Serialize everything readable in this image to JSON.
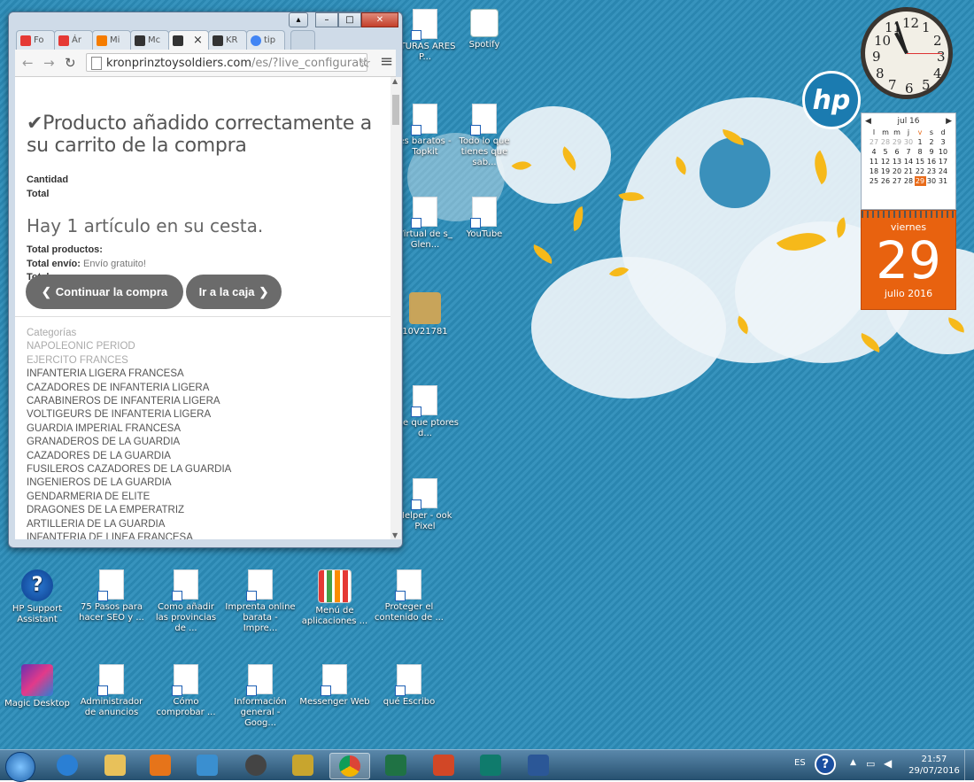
{
  "browser": {
    "tabs": [
      {
        "label": "Fo",
        "color": "#e53935"
      },
      {
        "label": "Ár",
        "color": "#e53935"
      },
      {
        "label": "Mi",
        "color": "#f57c00"
      },
      {
        "label": "Mc",
        "color": "#333333"
      },
      {
        "label": "",
        "color": "#333333"
      },
      {
        "label": "KR",
        "color": "#333333"
      },
      {
        "label": "tip",
        "color": "#4285f4"
      }
    ],
    "active_tab_close": "×",
    "url_domain": "kronprinztoysoldiers.com",
    "url_path": "/es/?live_configurato",
    "menu_icon": "≡",
    "star_icon": "☆"
  },
  "page": {
    "success_title": "Producto añadido correctamente a su carrito de la compra",
    "quantity_label": "Cantidad",
    "total_label": "Total",
    "cart_heading": "Hay 1 artículo en su cesta.",
    "total_products_label": "Total productos:",
    "shipping_label": "Total envío:",
    "shipping_value": "Envío gratuito!",
    "total_label_2": "Total",
    "continue_button": "Continuar la compra",
    "checkout_button": "Ir a la caja",
    "categories_heading": "Categorías",
    "categories": [
      "NAPOLEONIC PERIOD",
      "EJERCITO FRANCES",
      "INFANTERIA LIGERA FRANCESA",
      "CAZADORES DE INFANTERIA LIGERA",
      "CARABINEROS DE INFANTERIA LIGERA",
      "VOLTIGEURS DE INFANTERIA LIGERA",
      "GUARDIA IMPERIAL FRANCESA",
      "GRANADEROS DE LA GUARDIA",
      "CAZADORES DE LA GUARDIA",
      "FUSILEROS CAZADORES DE LA GUARDIA",
      "INGENIEROS DE LA GUARDIA",
      "GENDARMERIA DE ELITE",
      "DRAGONES DE LA EMPERATRIZ",
      "ARTILLERIA DE LA GUARDIA",
      "INFANTERIA DE LINEA FRANCESA"
    ]
  },
  "desktop": {
    "icons_right": [
      {
        "label": "Spotify"
      },
      {
        "label": "Todo lo que tienes que sab..."
      },
      {
        "label": "YouTube"
      }
    ],
    "partial_labels": [
      "ATURAS ARES P...",
      "es baratos - Topkit",
      "Virtual de s_ Glen...",
      "10V21781",
      "nite que ptores d...",
      "Helper - ook Pixel"
    ],
    "icons_row1": [
      {
        "label": "HP Support Assistant"
      },
      {
        "label": "75 Pasos para hacer SEO y ..."
      },
      {
        "label": "Como añadir las provincias de ..."
      },
      {
        "label": "Imprenta online barata - Impre..."
      },
      {
        "label": "Menú de aplicaciones ..."
      },
      {
        "label": "Proteger el contenido de ..."
      }
    ],
    "icons_row2": [
      {
        "label": "Magic Desktop"
      },
      {
        "label": "Administrador de anuncios"
      },
      {
        "label": "Cómo comprobar ..."
      },
      {
        "label": "Información general - Goog..."
      },
      {
        "label": "Messenger Web"
      },
      {
        "label": "qué Escribo"
      }
    ]
  },
  "gadgets": {
    "clock_numbers": [
      "12",
      "1",
      "2",
      "3",
      "4",
      "5",
      "6",
      "7",
      "8",
      "9",
      "10",
      "11"
    ],
    "calendar_month": "jul 16",
    "calendar_days_header": [
      "l",
      "m",
      "m",
      "j",
      "v",
      "s",
      "d"
    ],
    "calendar_weeks": [
      [
        "27",
        "28",
        "29",
        "30",
        "1",
        "2",
        "3"
      ],
      [
        "4",
        "5",
        "6",
        "7",
        "8",
        "9",
        "10"
      ],
      [
        "11",
        "12",
        "13",
        "14",
        "15",
        "16",
        "17"
      ],
      [
        "18",
        "19",
        "20",
        "21",
        "22",
        "23",
        "24"
      ],
      [
        "25",
        "26",
        "27",
        "28",
        "29",
        "30",
        "31"
      ]
    ],
    "day_name": "viernes",
    "day_number": "29",
    "month_year": "julio 2016"
  },
  "taskbar": {
    "language": "ES",
    "time": "21:57",
    "date": "29/07/2016",
    "apps": [
      {
        "name": "internet-explorer",
        "color": "#2a7fd4"
      },
      {
        "name": "file-explorer",
        "color": "#e8c15a"
      },
      {
        "name": "media-player",
        "color": "#e6741a"
      },
      {
        "name": "remote",
        "color": "#3a8fd0"
      },
      {
        "name": "hp",
        "color": "#444"
      },
      {
        "name": "film",
        "color": "#c8a52e"
      },
      {
        "name": "chrome",
        "color": "#db4437"
      },
      {
        "name": "excel",
        "color": "#1f7244"
      },
      {
        "name": "powerpoint",
        "color": "#d24726"
      },
      {
        "name": "publisher",
        "color": "#0f7b6c"
      },
      {
        "name": "word",
        "color": "#2b5797"
      }
    ]
  }
}
